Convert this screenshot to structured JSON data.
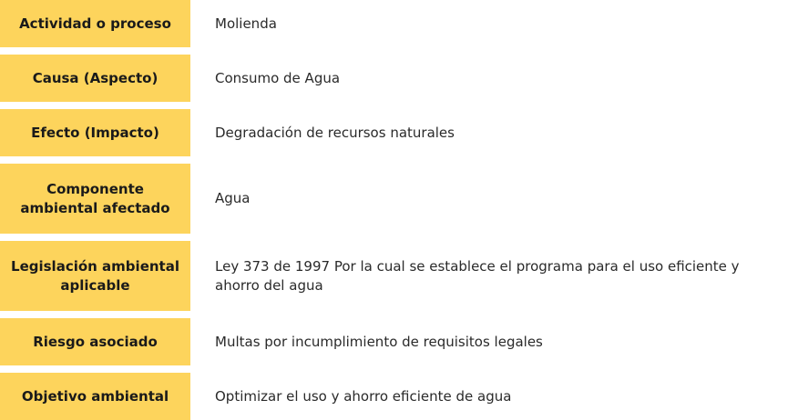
{
  "rows": [
    {
      "label": "Actividad o proceso",
      "value": "Molienda"
    },
    {
      "label": "Causa (Aspecto)",
      "value": "Consumo de Agua"
    },
    {
      "label": "Efecto (Impacto)",
      "value": "Degradación de recursos naturales"
    },
    {
      "label": "Componente ambiental afectado",
      "value": "Agua"
    },
    {
      "label": "Legislación ambiental aplicable",
      "value": "Ley 373 de 1997 Por la cual se establece el programa para el uso eficiente y ahorro del agua"
    },
    {
      "label": "Riesgo asociado",
      "value": "Multas por incumplimiento de requisitos legales"
    },
    {
      "label": "Objetivo ambiental",
      "value": "Optimizar el uso y ahorro eficiente de agua"
    }
  ],
  "colors": {
    "label_background": "#fdd45c",
    "label_text": "#1a1a1a",
    "value_text": "#2a2a2a"
  }
}
